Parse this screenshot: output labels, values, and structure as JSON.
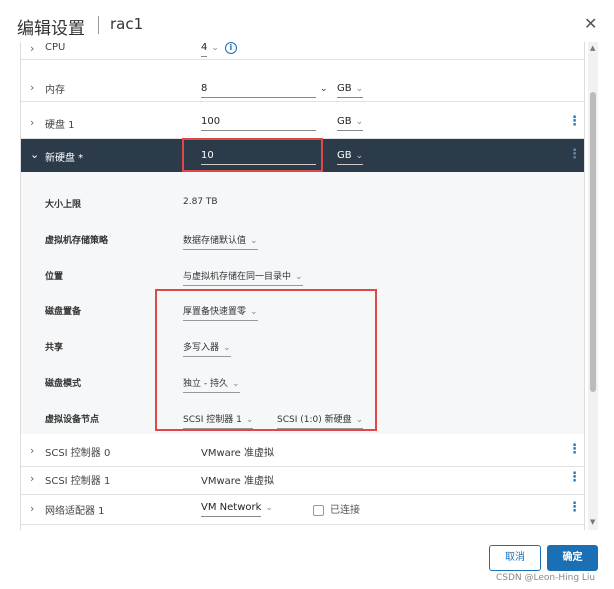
{
  "dialog": {
    "title": "编辑设置",
    "vm_name": "rac1",
    "close_glyph": "✕"
  },
  "rows": {
    "cpu": {
      "label": "CPU",
      "value": "4"
    },
    "memory": {
      "label": "内存",
      "value": "8",
      "unit": "GB"
    },
    "disk1": {
      "label": "硬盘 1",
      "value": "100",
      "unit": "GB"
    },
    "newdisk": {
      "label": "新硬盘 *",
      "value": "10",
      "unit": "GB"
    },
    "scsi0": {
      "label": "SCSI 控制器 0",
      "value": "VMware 准虚拟"
    },
    "scsi1": {
      "label": "SCSI 控制器 1",
      "value": "VMware 准虚拟"
    },
    "nic1": {
      "label": "网络适配器 1",
      "value": "VM Network",
      "connected_label": "已连接"
    }
  },
  "newdisk_props": {
    "max_size": {
      "label": "大小上限",
      "value": "2.87 TB"
    },
    "storage_policy": {
      "label": "虚拟机存储策略",
      "value": "数据存储默认值"
    },
    "location": {
      "label": "位置",
      "value": "与虚拟机存储在同一目录中"
    },
    "provisioning": {
      "label": "磁盘置备",
      "value": "厚置备快速置零"
    },
    "sharing": {
      "label": "共享",
      "value": "多写入器"
    },
    "disk_mode": {
      "label": "磁盘模式",
      "value": "独立 - 持久"
    },
    "vdev_node": {
      "label": "虚拟设备节点",
      "controller": "SCSI 控制器 1",
      "node": "SCSI (1:0) 新硬盘"
    }
  },
  "buttons": {
    "cancel": "取消",
    "ok": "确定"
  },
  "watermark": "CSDN @Leon-Hing Liu",
  "icons": {
    "chevron_right": "›",
    "chevron_down": "⌄",
    "caret": "⌄",
    "kebab": "⋮",
    "info": "i"
  },
  "colors": {
    "accent": "#1b6fb5",
    "dark_row": "#2b3b4a",
    "highlight": "#e04848"
  }
}
